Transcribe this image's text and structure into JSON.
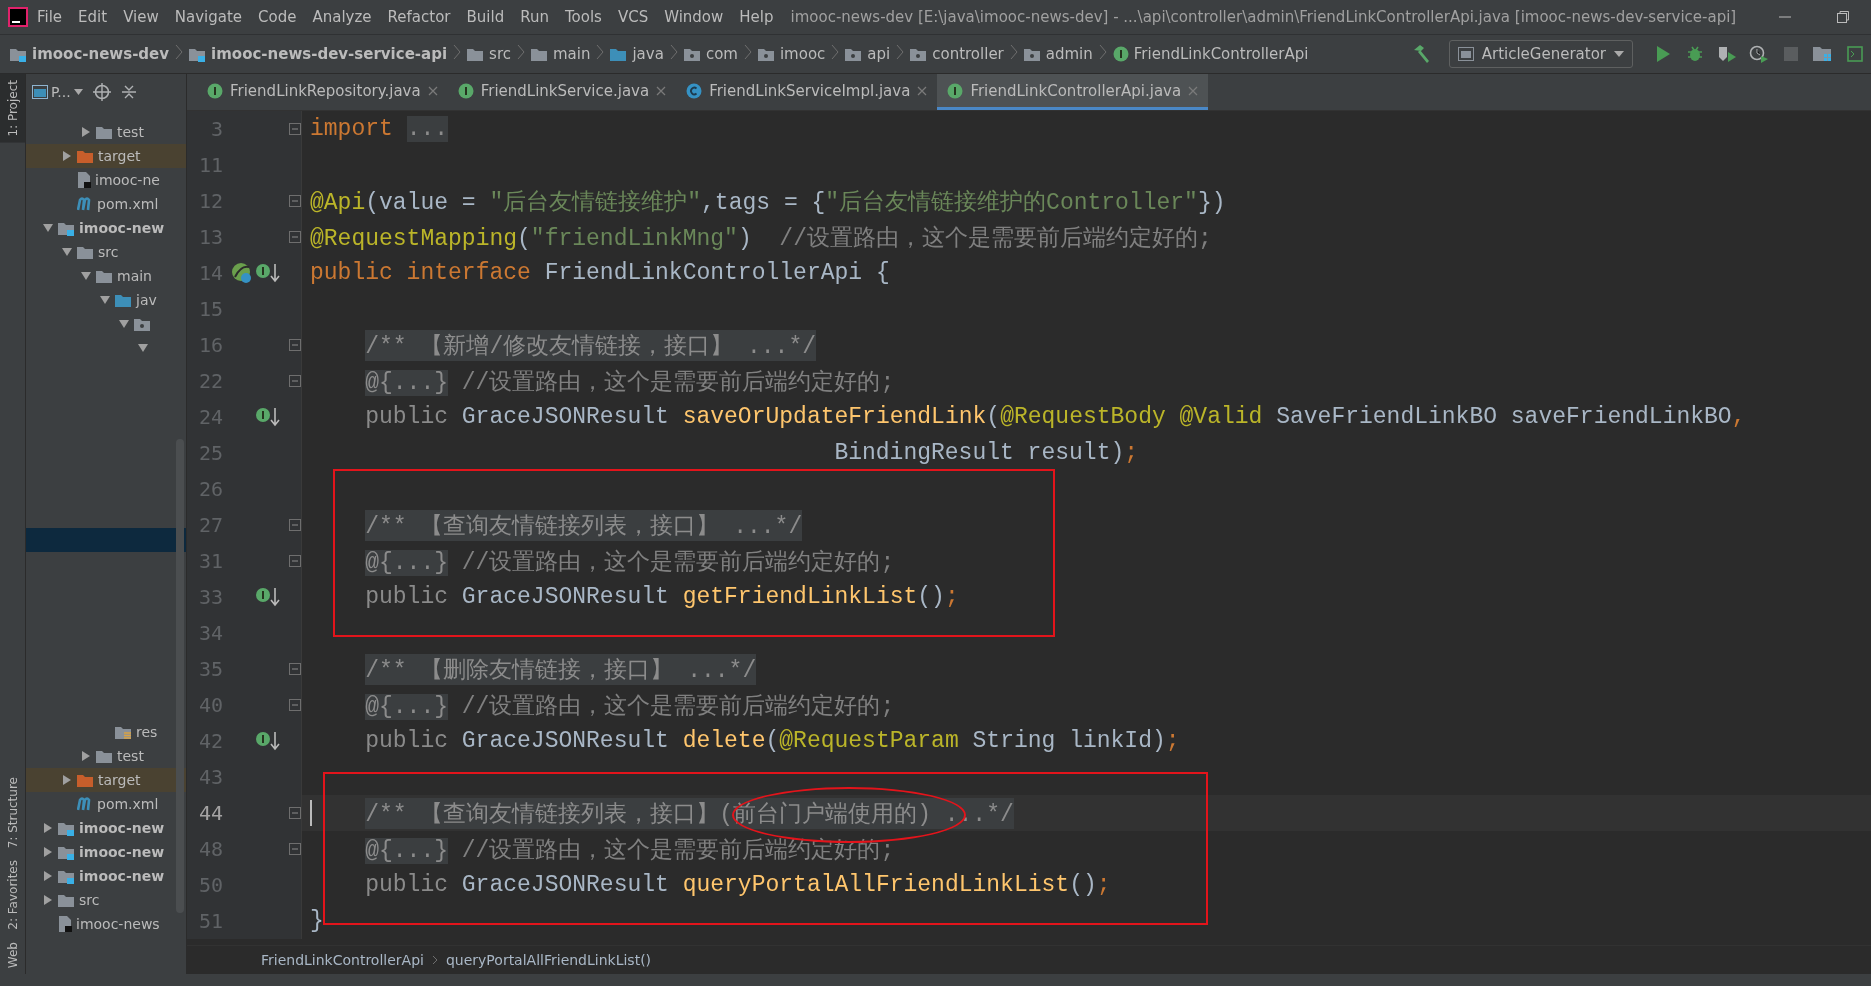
{
  "window": {
    "title": "imooc-news-dev [E:\\java\\imooc-news-dev] - ...\\api\\controller\\admin\\FriendLinkControllerApi.java [imooc-news-dev-service-api]"
  },
  "menu": [
    "File",
    "Edit",
    "View",
    "Navigate",
    "Code",
    "Analyze",
    "Refactor",
    "Build",
    "Run",
    "Tools",
    "VCS",
    "Window",
    "Help"
  ],
  "navigation": [
    {
      "label": "imooc-news-dev",
      "kind": "module"
    },
    {
      "label": "imooc-news-dev-service-api",
      "kind": "module"
    },
    {
      "label": "src",
      "kind": "folder"
    },
    {
      "label": "main",
      "kind": "folder"
    },
    {
      "label": "java",
      "kind": "source_folder"
    },
    {
      "label": "com",
      "kind": "package"
    },
    {
      "label": "imooc",
      "kind": "package"
    },
    {
      "label": "api",
      "kind": "package"
    },
    {
      "label": "controller",
      "kind": "package"
    },
    {
      "label": "admin",
      "kind": "package"
    },
    {
      "label": "FriendLinkControllerApi",
      "kind": "interface"
    }
  ],
  "run_configuration": "ArticleGenerator",
  "side_tools": [
    {
      "label": "1: Project",
      "selected": true
    },
    {
      "label": "7: Structure",
      "selected": false
    },
    {
      "label": "2: Favorites",
      "selected": false
    },
    {
      "label": "Web",
      "selected": false
    }
  ],
  "project_panel": {
    "title": "P...",
    "tree": [
      {
        "kind": "group",
        "children": [
          {
            "kind": "group",
            "children": [
              {
                "label": "test",
                "kind": "folder",
                "expanded": false
              }
            ]
          },
          {
            "label": "target",
            "kind": "folder_excluded",
            "expanded": false,
            "excluded": true
          },
          {
            "label": "imooc-ne",
            "kind": "file"
          },
          {
            "label": "pom.xml",
            "kind": "maven"
          }
        ]
      },
      {
        "label": "imooc-new",
        "kind": "module",
        "expanded": true,
        "bold": true,
        "children": [
          {
            "label": "src",
            "kind": "folder",
            "expanded": true,
            "children": [
              {
                "label": "main",
                "kind": "folder",
                "expanded": true,
                "children": [
                  {
                    "label": "jav",
                    "kind": "source_folder",
                    "expanded": true,
                    "children": [
                      {
                        "kind": "package",
                        "expanded": true,
                        "children": [
                          {
                            "expanded": true,
                            "children": [
                              {
                                "kind": "blank",
                                "selected": false
                              },
                              {
                                "kind": "blank",
                                "selected": false
                              },
                              {
                                "kind": "blank",
                                "selected": false
                              },
                              {
                                "kind": "blank",
                                "selected": false
                              },
                              {
                                "kind": "blank",
                                "selected": false
                              },
                              {
                                "kind": "blank",
                                "selected": false
                              },
                              {
                                "kind": "blank",
                                "selected": false
                              },
                              {
                                "kind": "blank",
                                "selected": true
                              },
                              {
                                "kind": "blank",
                                "selected": false
                              },
                              {
                                "kind": "blank",
                                "selected": false
                              },
                              {
                                "kind": "blank",
                                "selected": false
                              },
                              {
                                "kind": "blank",
                                "selected": false
                              },
                              {
                                "kind": "blank",
                                "selected": false
                              },
                              {
                                "kind": "blank",
                                "selected": false
                              },
                              {
                                "kind": "blank",
                                "selected": false
                              }
                            ]
                          }
                        ]
                      }
                    ]
                  },
                  {
                    "label": "res",
                    "kind": "resources"
                  }
                ]
              },
              {
                "label": "test",
                "kind": "folder",
                "expanded": false
              }
            ]
          },
          {
            "label": "target",
            "kind": "folder_excluded",
            "expanded": false,
            "excluded": true
          },
          {
            "label": "pom.xml",
            "kind": "maven"
          }
        ]
      },
      {
        "label": "imooc-new",
        "kind": "module",
        "expanded": false,
        "bold": true
      },
      {
        "label": "imooc-new",
        "kind": "module",
        "expanded": false,
        "bold": true
      },
      {
        "label": "imooc-new",
        "kind": "module",
        "expanded": false,
        "bold": true
      },
      {
        "label": "src",
        "kind": "folder",
        "expanded": false
      },
      {
        "label": "imooc-news",
        "kind": "file"
      }
    ]
  },
  "tabs": [
    {
      "label": "FriendLinkRepository.java",
      "kind": "interface",
      "selected": false
    },
    {
      "label": "FriendLinkService.java",
      "kind": "interface",
      "selected": false
    },
    {
      "label": "FriendLinkServiceImpl.java",
      "kind": "class",
      "selected": false
    },
    {
      "label": "FriendLinkControllerApi.java",
      "kind": "interface",
      "selected": true
    }
  ],
  "editor": {
    "lines": [
      {
        "number": "3",
        "fold": true,
        "tokens": [
          {
            "kind": "keyword",
            "text": "import "
          },
          {
            "kind": "folded",
            "text": "..."
          }
        ]
      },
      {
        "number": "11"
      },
      {
        "number": "12",
        "fold": true,
        "tokens": [
          {
            "kind": "annotation",
            "text": "@Api"
          },
          {
            "kind": "plain",
            "text": "(value = "
          },
          {
            "kind": "string",
            "text": "\"后台友情链接维护\""
          },
          {
            "kind": "plain",
            "text": ",tags = {"
          },
          {
            "kind": "string",
            "text": "\"后台友情链接维护的Controller\""
          },
          {
            "kind": "plain",
            "text": "})"
          }
        ]
      },
      {
        "number": "13",
        "fold": true,
        "tokens": [
          {
            "kind": "annotation",
            "text": "@RequestMapping"
          },
          {
            "kind": "plain",
            "text": "("
          },
          {
            "kind": "string",
            "text": "\"friendLinkMng\""
          },
          {
            "kind": "plain",
            "text": ")"
          },
          {
            "kind": "comment",
            "text": "  //设置路由，这个是需要前后端约定好的;"
          }
        ]
      },
      {
        "number": "14",
        "kind": "implemented_by",
        "tokens": [
          {
            "kind": "keyword",
            "text": "public interface "
          },
          {
            "kind": "plain",
            "text": "FriendLinkControllerApi {"
          }
        ]
      },
      {
        "number": "15"
      },
      {
        "number": "16",
        "fold": true,
        "nested": true,
        "tokens": [
          {
            "kind": "folded",
            "text": "/** 【新增/修改友情链接，接口】 ...*/"
          }
        ]
      },
      {
        "number": "22",
        "fold": true,
        "nested": true,
        "tokens": [
          {
            "kind": "folded",
            "text": "@{...}"
          },
          {
            "kind": "comment",
            "text": " //设置路由，这个是需要前后端约定好的;"
          }
        ]
      },
      {
        "number": "24",
        "kind": "implemented",
        "nested": true,
        "tokens": [
          {
            "kind": "redundant",
            "text": "public "
          },
          {
            "kind": "plain",
            "text": "GraceJSONResult "
          },
          {
            "kind": "method",
            "text": "saveOrUpdateFriendLink"
          },
          {
            "kind": "plain",
            "text": "("
          },
          {
            "kind": "annotation",
            "text": "@RequestBody @Valid"
          },
          {
            "kind": "plain",
            "text": " SaveFriendLinkBO saveFriendLinkBO"
          },
          {
            "kind": "keyword",
            "text": ","
          }
        ]
      },
      {
        "number": "25",
        "wrapped": true,
        "tokens": [
          {
            "kind": "plain",
            "text": "BindingResult result)"
          },
          {
            "kind": "keyword",
            "text": ";"
          }
        ]
      },
      {
        "number": "26"
      },
      {
        "number": "27",
        "fold": true,
        "nested": true,
        "tokens": [
          {
            "kind": "folded",
            "text": "/** 【查询友情链接列表，接口】 ...*/"
          }
        ]
      },
      {
        "number": "31",
        "fold": true,
        "nested": true,
        "tokens": [
          {
            "kind": "folded",
            "text": "@{...}"
          },
          {
            "kind": "comment",
            "text": " //设置路由，这个是需要前后端约定好的;"
          }
        ]
      },
      {
        "number": "33",
        "kind": "implemented",
        "nested": true,
        "tokens": [
          {
            "kind": "redundant",
            "text": "public "
          },
          {
            "kind": "plain",
            "text": "GraceJSONResult "
          },
          {
            "kind": "method",
            "text": "getFriendLinkList"
          },
          {
            "kind": "plain",
            "text": "()"
          },
          {
            "kind": "keyword",
            "text": ";"
          }
        ]
      },
      {
        "number": "34"
      },
      {
        "number": "35",
        "fold": true,
        "nested": true,
        "tokens": [
          {
            "kind": "folded",
            "text": "/** 【删除友情链接，接口】 ...*/"
          }
        ]
      },
      {
        "number": "40",
        "fold": true,
        "nested": true,
        "tokens": [
          {
            "kind": "folded",
            "text": "@{...}"
          },
          {
            "kind": "comment",
            "text": " //设置路由，这个是需要前后端约定好的;"
          }
        ]
      },
      {
        "number": "42",
        "kind": "implemented",
        "nested": true,
        "tokens": [
          {
            "kind": "redundant",
            "text": "public "
          },
          {
            "kind": "plain",
            "text": "GraceJSONResult "
          },
          {
            "kind": "method",
            "text": "delete"
          },
          {
            "kind": "plain",
            "text": "("
          },
          {
            "kind": "annotation",
            "text": "@RequestParam"
          },
          {
            "kind": "plain",
            "text": " String linkId)"
          },
          {
            "kind": "keyword",
            "text": ";"
          }
        ]
      },
      {
        "number": "43"
      },
      {
        "number": "44",
        "fold": true,
        "nested": true,
        "current": true,
        "tokens": [
          {
            "kind": "folded",
            "text": "/** 【查询友情链接列表，接口】(前台门户端使用的) ...*/"
          }
        ]
      },
      {
        "number": "48",
        "fold": true,
        "nested": true,
        "tokens": [
          {
            "kind": "folded",
            "text": "@{...}"
          },
          {
            "kind": "comment",
            "text": " //设置路由，这个是需要前后端约定好的;"
          }
        ]
      },
      {
        "number": "50",
        "nested": true,
        "tokens": [
          {
            "kind": "redundant",
            "text": "public "
          },
          {
            "kind": "plain",
            "text": "GraceJSONResult "
          },
          {
            "kind": "method",
            "text": "queryPortalAllFriendLinkList"
          },
          {
            "kind": "plain",
            "text": "()"
          },
          {
            "kind": "keyword",
            "text": ";"
          }
        ]
      },
      {
        "number": "51",
        "tokens": [
          {
            "kind": "plain",
            "text": "}"
          }
        ]
      }
    ],
    "annotations": [
      {
        "kind": "rectangle"
      },
      {
        "kind": "rectangle"
      },
      {
        "kind": "ellipse"
      }
    ]
  },
  "breadcrumbs": [
    "FriendLinkControllerApi",
    "queryPortalAllFriendLinkList()"
  ]
}
